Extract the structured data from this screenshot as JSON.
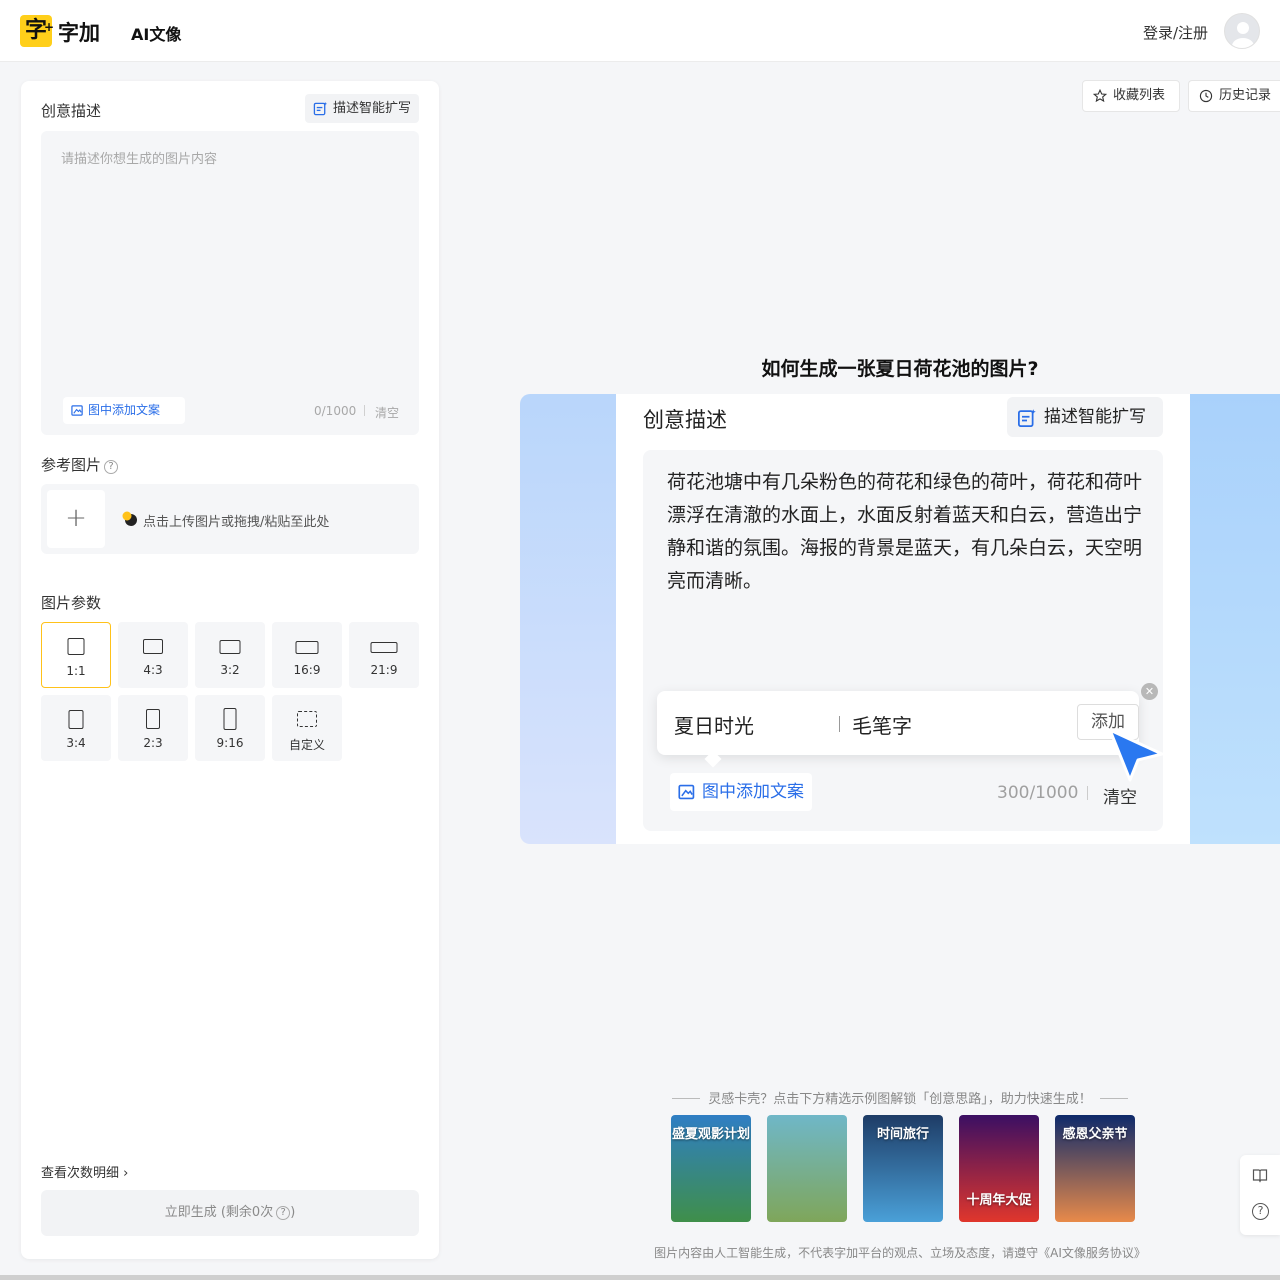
{
  "header": {
    "logo_char": "字",
    "logo_text": "字加",
    "nav_ai": "AI文像",
    "login": "登录/注册"
  },
  "left": {
    "creative_title": "创意描述",
    "expand_label": "描述智能扩写",
    "placeholder": "请描述你想生成的图片内容",
    "add_text_label": "图中添加文案",
    "char_count": "0/1000",
    "clear_label": "清空",
    "ref_title": "参考图片",
    "upload_hint": "点击上传图片或拖拽/粘贴至此处",
    "params_title": "图片参数",
    "ratios": [
      {
        "label": "1:1"
      },
      {
        "label": "4:3"
      },
      {
        "label": "3:2"
      },
      {
        "label": "16:9"
      },
      {
        "label": "21:9"
      },
      {
        "label": "3:4"
      },
      {
        "label": "2:3"
      },
      {
        "label": "9:16"
      },
      {
        "label": "自定义"
      }
    ],
    "selected_ratio": "1:1",
    "count_detail": "查看次数明细",
    "generate_label": "立即生成 (剩余0次",
    "generate_suffix": ")"
  },
  "top": {
    "favorites": "收藏列表",
    "history": "历史记录"
  },
  "demo": {
    "title": "如何生成一张夏日荷花池的图片?",
    "creative_title": "创意描述",
    "expand_label": "描述智能扩写",
    "text": "荷花池塘中有几朵粉色的荷花和绿色的荷叶，荷花和荷叶漂浮在清澈的水面上，水面反射着蓝天和白云，营造出宁静和谐的氛围。海报的背景是蓝天，有几朵白云，天空明亮而清晰。",
    "popup_text": "夏日时光",
    "popup_font": "毛笔字",
    "popup_add": "添加",
    "add_text_label": "图中添加文案",
    "char_count": "300/1000",
    "clear_label": "清空"
  },
  "inspiration": {
    "line": "灵感卡壳？点击下方精选示例图解锁「创意思路」，助力快速生成！",
    "thumbs": [
      {
        "caption": "盛夏观影计划",
        "colors": [
          "#2f7ec4",
          "#3f8f4a"
        ]
      },
      {
        "caption": "",
        "colors": [
          "#6fb7c8",
          "#7fa65a"
        ]
      },
      {
        "caption": "时间旅行",
        "colors": [
          "#1e3c66",
          "#4aa0d8"
        ]
      },
      {
        "caption": "十周年大促",
        "colors": [
          "#3b0f63",
          "#e0362c"
        ]
      },
      {
        "caption": "感恩父亲节",
        "colors": [
          "#0e2a6b",
          "#e88a4a"
        ]
      }
    ]
  },
  "footer": "图片内容由人工智能生成，不代表字加平台的观点、立场及态度，请遵守《AI文像服务协议》"
}
